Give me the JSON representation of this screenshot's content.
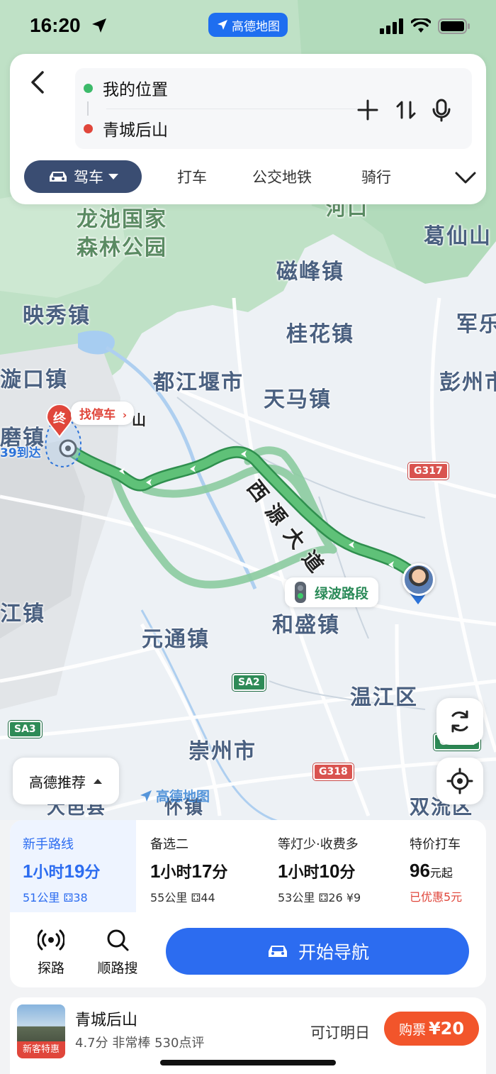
{
  "status_bar": {
    "time": "16:20",
    "app_name": "高德地图"
  },
  "route": {
    "origin": "我的位置",
    "destination": "青城后山",
    "origin_color": "#3cba6a",
    "destination_color": "#e0463b"
  },
  "modes": {
    "drive": "驾车",
    "taxi": "打车",
    "transit": "公交地铁",
    "bike": "骑行"
  },
  "map": {
    "places": {
      "longchi": "龙池国家",
      "longchi2": "森林公园",
      "yingxiu": "映秀镇",
      "cifeng": "磁峰镇",
      "gexian": "葛仙山",
      "guihua": "桂花镇",
      "junle": "军乐",
      "dujiangyan": "都江堰市",
      "tianma": "天马镇",
      "pengzhou": "彭州市",
      "xuankou": "漩口镇",
      "mozhen": "磨镇",
      "jiangzhen": "江镇",
      "yuantong": "元通镇",
      "hesheng": "和盛镇",
      "wenjiang": "温江区",
      "chongzhou": "崇州市",
      "dayi": "大邑县",
      "huaixiang": "怀镇",
      "shuangliu": "双流区",
      "hekou": "河口",
      "xiyuan_road": "西源大道",
      "shan": "山"
    },
    "shields": {
      "g317": "G317",
      "sa2": "SA2",
      "sa3": "SA3",
      "g318": "G318",
      "g4202": "G4202"
    },
    "route_color": "#4db168",
    "alt_route_color": "#8ccca0"
  },
  "overlays": {
    "end_marker": "终",
    "find_parking": "找停车",
    "arrive_time": "39到达",
    "green_wave": "绿波路段",
    "recommend": "高德推荐",
    "watermark": "高德地图"
  },
  "routes": [
    {
      "name": "新手路线",
      "hours": "1",
      "mins": "19",
      "distance": "51公里",
      "lights": "38",
      "toll": ""
    },
    {
      "name": "备选二",
      "hours": "1",
      "mins": "17",
      "distance": "55公里",
      "lights": "44",
      "toll": ""
    },
    {
      "name": "等灯少·收费多",
      "hours": "1",
      "mins": "10",
      "distance": "53公里",
      "lights": "26",
      "toll": "¥9"
    }
  ],
  "taxi_offer": {
    "name": "特价打车",
    "price": "96",
    "price_suffix": "元起",
    "discount": "已优惠5元"
  },
  "units": {
    "hour": "小时",
    "minute": "分"
  },
  "actions": {
    "explore": "探路",
    "along_search": "顺路搜",
    "start_nav": "开始导航"
  },
  "poi": {
    "name": "青城后山",
    "rating": "4.7分  非常棒  530点评",
    "badge": "新客特惠",
    "book_text": "可订明日",
    "buy_label": "购票",
    "buy_price": "¥20"
  }
}
